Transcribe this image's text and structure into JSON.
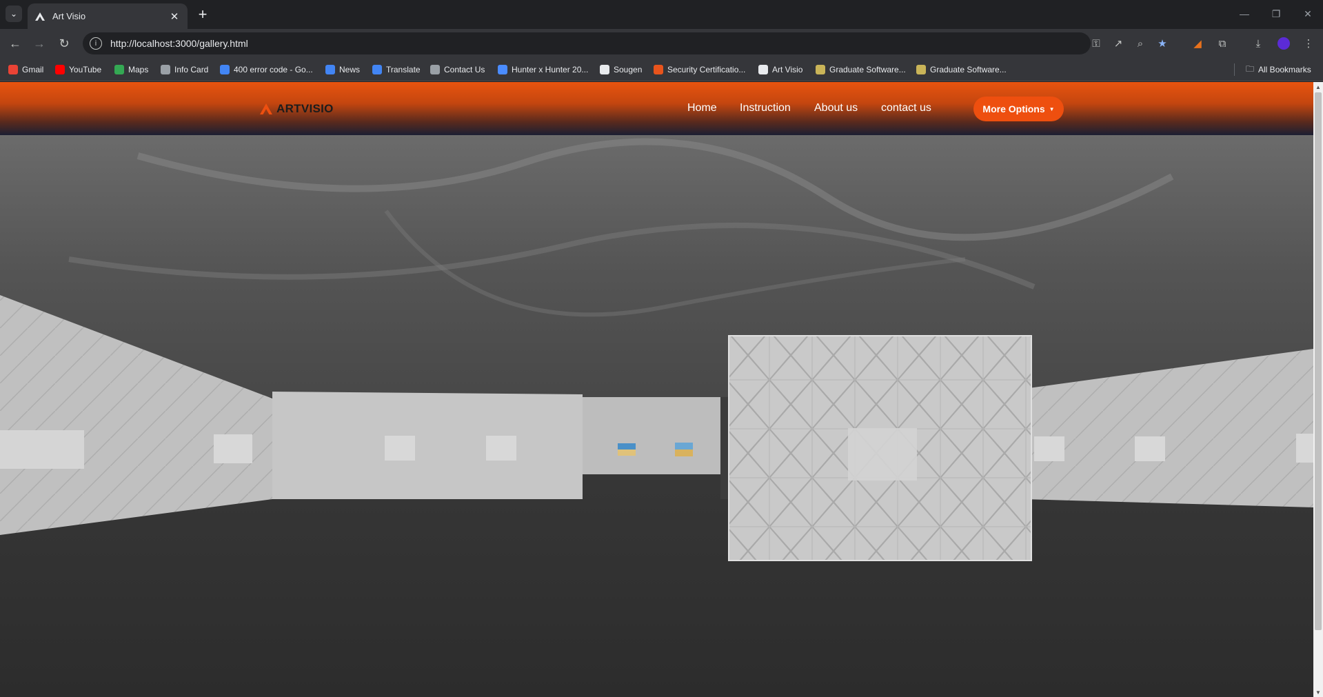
{
  "browser": {
    "tab_title": "Art Visio",
    "url": "http://localhost:3000/gallery.html",
    "bookmarks": [
      {
        "label": "Gmail",
        "icon": "gmail-icon",
        "color": "#ea4335"
      },
      {
        "label": "YouTube",
        "icon": "youtube-icon",
        "color": "#ff0000"
      },
      {
        "label": "Maps",
        "icon": "maps-icon",
        "color": "#34a853"
      },
      {
        "label": "Info Card",
        "icon": "globe-icon",
        "color": "#9aa0a6"
      },
      {
        "label": "400 error code - Go...",
        "icon": "google-icon",
        "color": "#4285f4"
      },
      {
        "label": "News",
        "icon": "news-icon",
        "color": "#4285f4"
      },
      {
        "label": "Translate",
        "icon": "translate-icon",
        "color": "#4285f4"
      },
      {
        "label": "Contact Us",
        "icon": "contact-icon",
        "color": "#9aa0a6"
      },
      {
        "label": "Hunter x Hunter 20...",
        "icon": "play-icon",
        "color": "#4a8cff"
      },
      {
        "label": "Sougen",
        "icon": "loading-icon",
        "color": "#e8eaed"
      },
      {
        "label": "Security Certificatio...",
        "icon": "certificate-icon",
        "color": "#e8541c"
      },
      {
        "label": "Art Visio",
        "icon": "artvisio-icon",
        "color": "#e8eaed"
      },
      {
        "label": "Graduate Software...",
        "icon": "doc-icon",
        "color": "#c9b458"
      },
      {
        "label": "Graduate Software...",
        "icon": "doc-icon",
        "color": "#c9b458"
      }
    ],
    "all_bookmarks": "All Bookmarks"
  },
  "site": {
    "logo": "ARTVISIO",
    "accent": "#ee4f0f",
    "nav": [
      "Home",
      "Instruction",
      "About us",
      "contact us"
    ],
    "more_options": "More Options"
  }
}
